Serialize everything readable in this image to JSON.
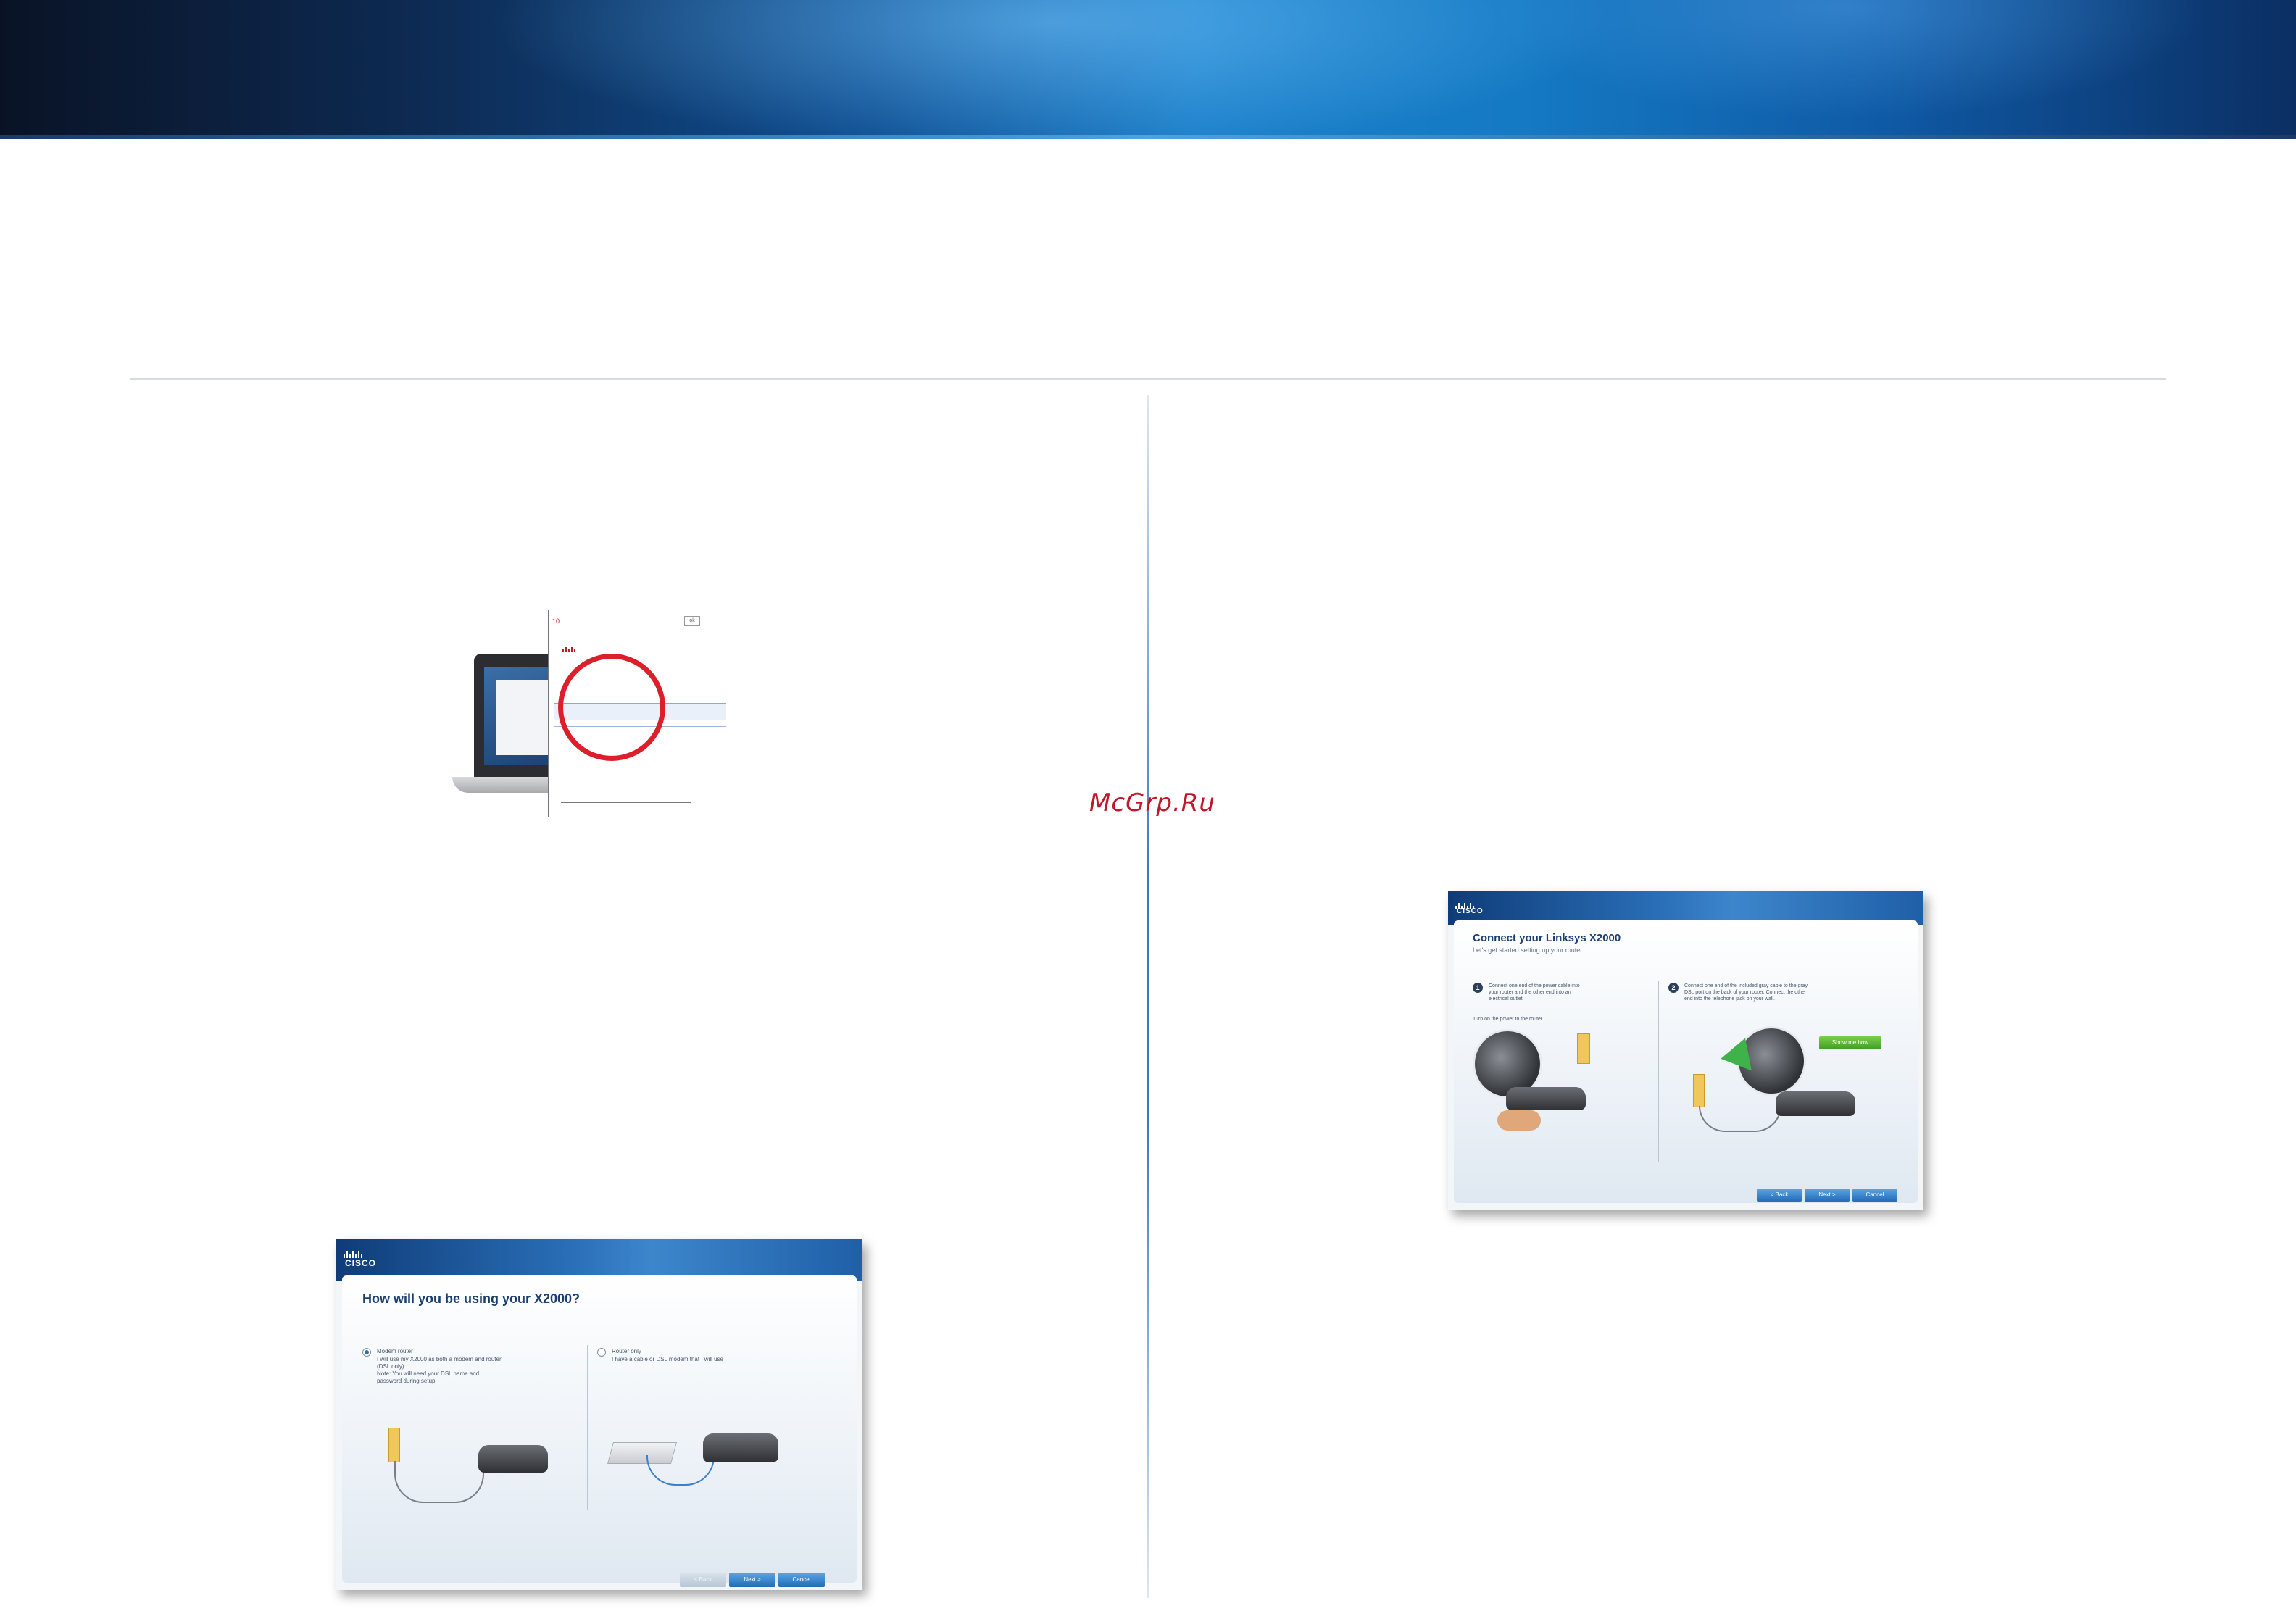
{
  "watermark": "McGrp.Ru",
  "laptop_panel": {
    "red_label": "10",
    "button_label": "ok"
  },
  "usage_window": {
    "brand": "CISCO",
    "title": "How will you be using your X2000?",
    "option_modem": {
      "label": "Modem router",
      "lines": [
        "I will use my X2000 as both a modem and router",
        "(DSL only)",
        "Note: You will need your DSL name and",
        "password during setup."
      ]
    },
    "option_router": {
      "label": "Router only",
      "lines": [
        "I have a cable or DSL modem that I will use"
      ]
    },
    "buttons": {
      "back": "< Back",
      "next": "Next >",
      "cancel": "Cancel"
    }
  },
  "connect_window": {
    "brand": "CISCO",
    "title": "Connect your Linksys X2000",
    "subtitle": "Let's get started setting up your router.",
    "step1": {
      "number": "1",
      "lines": [
        "Connect one end of the power cable into",
        "your router and the other end into an",
        "electrical outlet."
      ],
      "note": "Turn on the power to the router."
    },
    "step2": {
      "number": "2",
      "lines": [
        "Connect one end of the included gray cable to the gray",
        "DSL port on the back of your router. Connect the other",
        "end into the telephone jack on your wall."
      ]
    },
    "green_button": "Show me how",
    "buttons": {
      "back": "< Back",
      "next": "Next >",
      "cancel": "Cancel"
    }
  }
}
